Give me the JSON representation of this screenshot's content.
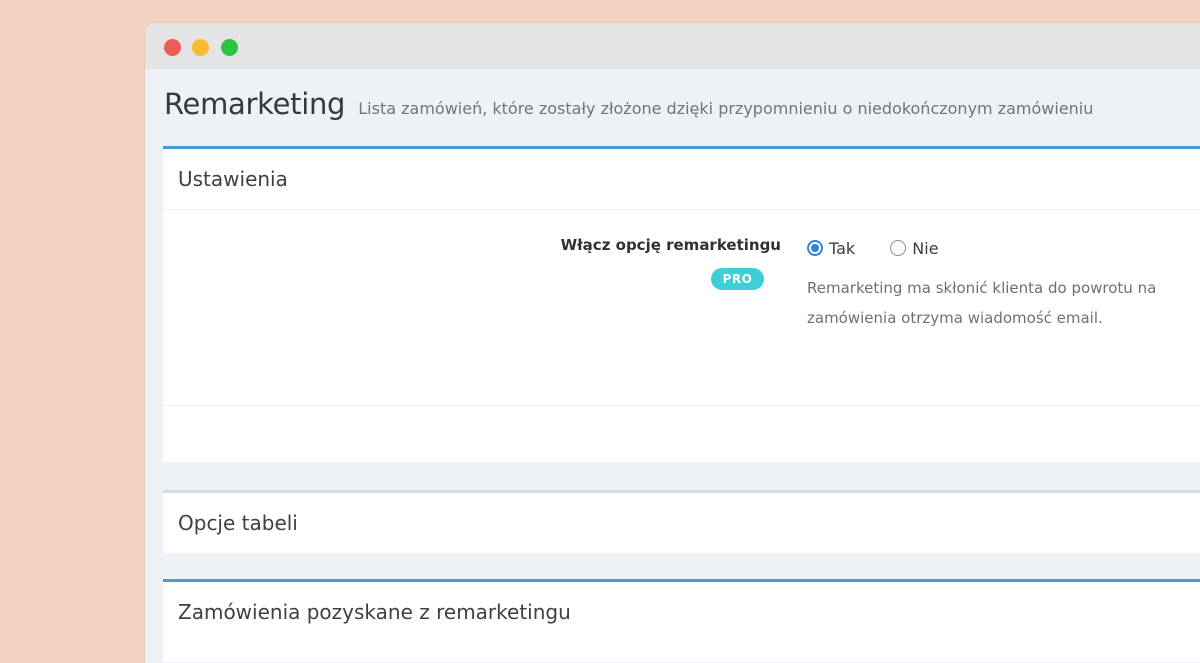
{
  "page": {
    "title": "Remarketing",
    "subtitle": "Lista zamówień, które zostały złożone dzięki przypomnieniu o niedokończonym zamówieniu"
  },
  "settings_panel": {
    "heading": "Ustawienia",
    "option_label": "Włącz opcję remarketingu",
    "badge": "PRO",
    "radios": [
      {
        "label": "Tak",
        "checked": true
      },
      {
        "label": "Nie",
        "checked": false
      }
    ],
    "help_lines": [
      "Remarketing ma skłonić klienta do powrotu na",
      "zamówienia otrzyma wiadomość email."
    ]
  },
  "table_options_panel": {
    "heading": "Opcje tabeli"
  },
  "orders_panel": {
    "heading": "Zamówienia pozyskane z remarketingu"
  },
  "colors": {
    "background": "#f2d3c1",
    "accent": "#4a9ad4",
    "badge": "#3ccfd6",
    "radio_checked": "#2d86d8"
  }
}
